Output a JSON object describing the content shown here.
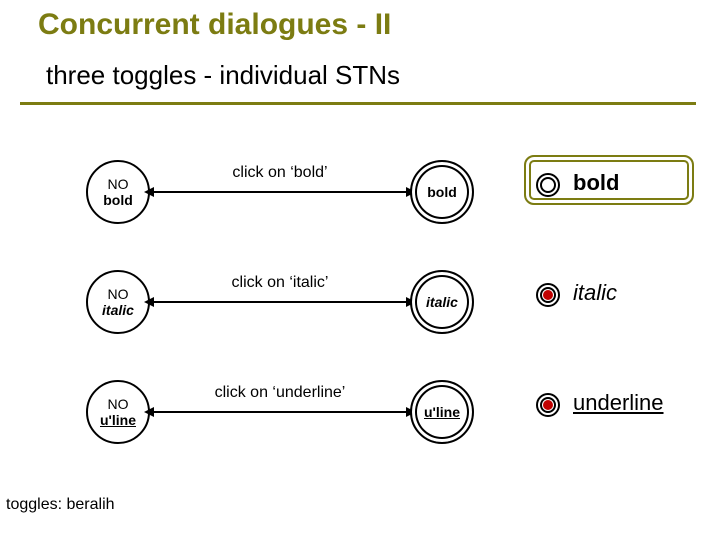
{
  "title": "Concurrent dialogues - II",
  "subtitle": "three toggles - individual STNs",
  "footnote": "toggles: beralih",
  "rows": [
    {
      "left_l1": "NO",
      "left_l2": "bold",
      "arrow_label": "click on ‘bold’",
      "right_text": "bold",
      "option_label": "bold",
      "option_style": "bold",
      "radio_filled": false
    },
    {
      "left_l1": "NO",
      "left_l2": "italic",
      "arrow_label": "click on ‘italic’",
      "right_text": "italic",
      "option_label": "italic",
      "option_style": "italic",
      "radio_filled": true
    },
    {
      "left_l1": "NO",
      "left_l2": "u'line",
      "arrow_label": "click on ‘underline’",
      "right_text": "u'line",
      "option_label": "underline",
      "option_style": "uline",
      "radio_filled": true
    }
  ]
}
